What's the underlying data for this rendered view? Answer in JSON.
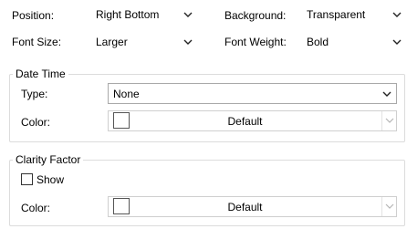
{
  "labels": {
    "position": "Position:",
    "background": "Background:",
    "font_size": "Font Size:",
    "font_weight": "Font Weight:"
  },
  "selects": {
    "position": "Right Bottom",
    "background": "Transparent",
    "font_size": "Larger",
    "font_weight": "Bold"
  },
  "date_time": {
    "legend": "Date Time",
    "type_label": "Type:",
    "type_value": "None",
    "color_label": "Color:",
    "color_value": "Default",
    "swatch_color": "#ffffff"
  },
  "clarity": {
    "legend": "Clarity Factor",
    "show_label": "Show",
    "show_checked": false,
    "color_label": "Color:",
    "color_value": "Default",
    "swatch_color": "#ffffff"
  },
  "colors": {
    "border": "#a9a9a9",
    "group_border": "#dcdcdc",
    "disabled_chevron": "#b5b5b5"
  }
}
